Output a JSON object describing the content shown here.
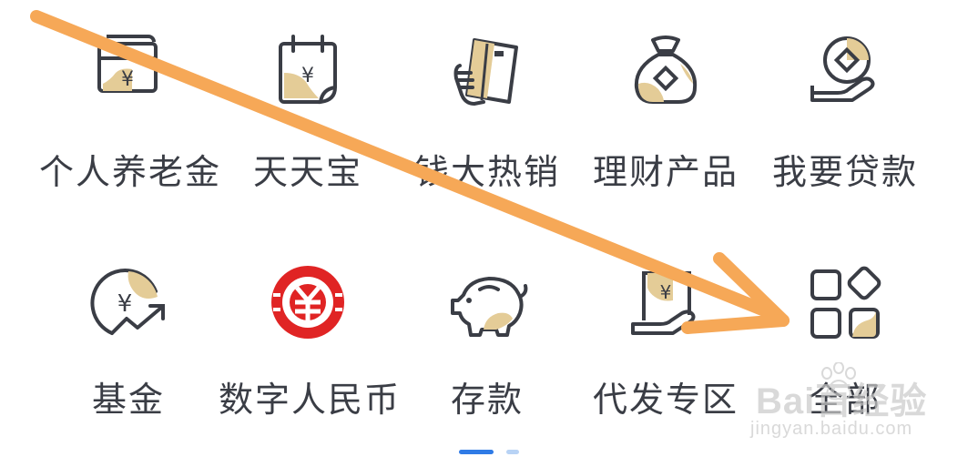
{
  "menu": {
    "items": [
      {
        "label": "个人养老金",
        "icon": "pension-card-icon"
      },
      {
        "label": "天天宝",
        "icon": "calendar-yuan-icon"
      },
      {
        "label": "钱大热销",
        "icon": "hand-card-icon"
      },
      {
        "label": "理财产品",
        "icon": "money-bag-icon"
      },
      {
        "label": "我要贷款",
        "icon": "hand-coin-icon"
      },
      {
        "label": "基金",
        "icon": "fund-growth-icon"
      },
      {
        "label": "数字人民币",
        "icon": "digital-rmb-icon"
      },
      {
        "label": "存款",
        "icon": "piggy-bank-icon"
      },
      {
        "label": "代发专区",
        "icon": "payroll-icon"
      },
      {
        "label": "全部",
        "icon": "all-apps-icon"
      }
    ]
  },
  "pager": {
    "pages": 2,
    "current": 1
  },
  "watermark": {
    "main": "Bai百经验",
    "sub": "jingyan.baidu.com"
  },
  "colors": {
    "line": "#3a3d45",
    "gold": "#d9b66e",
    "red": "#e02424",
    "arrow": "#f6a857",
    "pager_active": "#2f7be6"
  }
}
